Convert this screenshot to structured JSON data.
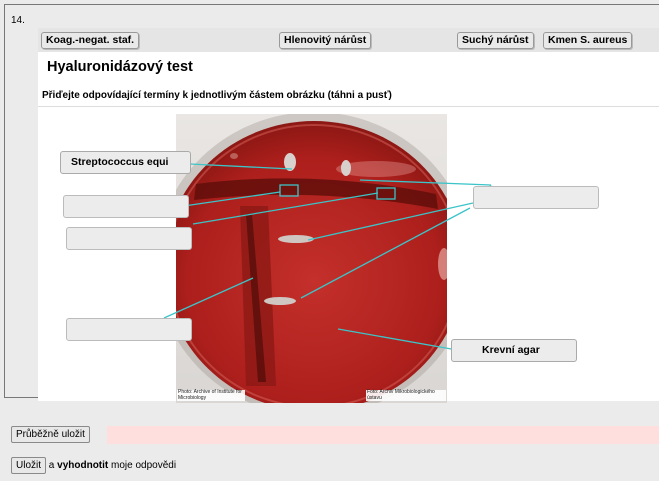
{
  "question_number": "14.",
  "terms": [
    "Koag.-negat. staf.",
    "Hlenovitý nárůst",
    "Suchý nárůst",
    "Kmen S. aureus"
  ],
  "title": "Hyaluronidázový test",
  "instruction": "Přiďejte odpovídající termíny k jednotlivým částem obrázku (táhni a pusť)",
  "image": {
    "credit_left": "Photo: Archive of Institute for Microbiology",
    "credit_right": "Foto: Archiv Mikrobiologického ústavu"
  },
  "placed_labels": {
    "top_left": "Streptococcus equi",
    "bottom_right": "Krevní agar"
  },
  "buttons": {
    "save_progress": "Průběžně uložit",
    "save": "Uložit",
    "connector": "a",
    "evaluate": "vyhodnotit",
    "suffix": "moje odpovědi"
  },
  "colors": {
    "plate_red": "#b3211e",
    "leader_lines": "#3cc4c8",
    "progress_bar": "#ffdede"
  }
}
